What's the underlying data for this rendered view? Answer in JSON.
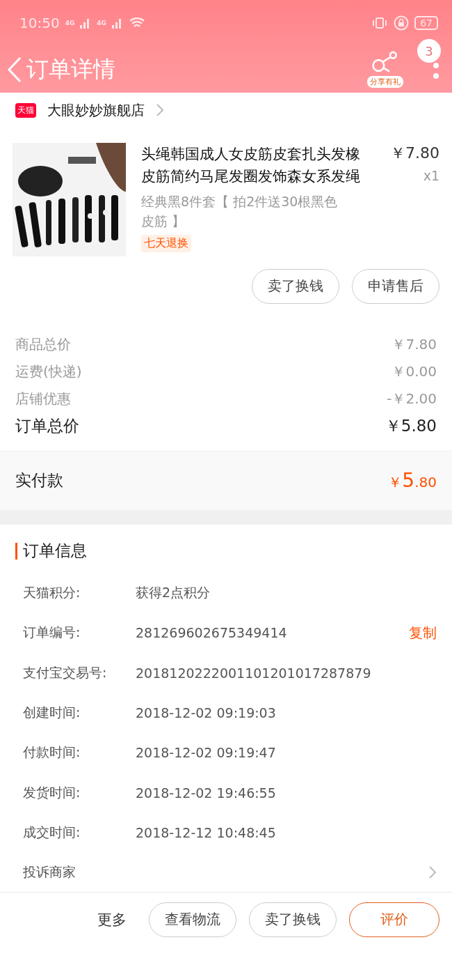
{
  "status_bar": {
    "time": "10:50",
    "network_1": "4G",
    "network_2": "4G",
    "battery": "67"
  },
  "header": {
    "title": "订单详情",
    "share_label": "分享有礼",
    "badge": "3"
  },
  "shop": {
    "badge": "天猫",
    "name": "大眼妙妙旗舰店"
  },
  "product": {
    "title": "头绳韩国成人女皮筋皮套扎头发橡皮筋简约马尾发圈发饰森女系发绳",
    "price": "￥7.80",
    "quantity": "x1",
    "sku": "经典黑8件套【 拍2件送30根黑色皮筋 】",
    "tag": "七天退换"
  },
  "product_actions": [
    "卖了换钱",
    "申请售后"
  ],
  "summary": [
    {
      "label": "商品总价",
      "value": "￥7.80"
    },
    {
      "label": "运费(快递)",
      "value": "￥0.00"
    },
    {
      "label": "店铺优惠",
      "value": "-￥2.00"
    }
  ],
  "total": {
    "label": "订单总价",
    "value": "￥5.80"
  },
  "paid": {
    "label": "实付款",
    "currency": "￥",
    "integer": "5",
    "decimal": ".80"
  },
  "order_info": {
    "title": "订单信息",
    "rows": [
      {
        "label": "天猫积分:",
        "value": "获得2点积分"
      },
      {
        "label": "订单编号:",
        "value": "281269602675349414",
        "action": "复制"
      },
      {
        "label": "支付宝交易号:",
        "value": "2018120222001101201017287879"
      },
      {
        "label": "创建时间:",
        "value": "2018-12-02 09:19:03"
      },
      {
        "label": "付款时间:",
        "value": "2018-12-02 09:19:47"
      },
      {
        "label": "发货时间:",
        "value": "2018-12-02 19:46:55"
      },
      {
        "label": "成交时间:",
        "value": "2018-12-12 10:48:45"
      }
    ]
  },
  "complaint": {
    "label": "投诉商家"
  },
  "bottom_bar": {
    "more": "更多",
    "buttons": [
      {
        "label": "查看物流",
        "kind": "normal"
      },
      {
        "label": "卖了换钱",
        "kind": "normal"
      },
      {
        "label": "评价",
        "kind": "primary"
      }
    ]
  }
}
